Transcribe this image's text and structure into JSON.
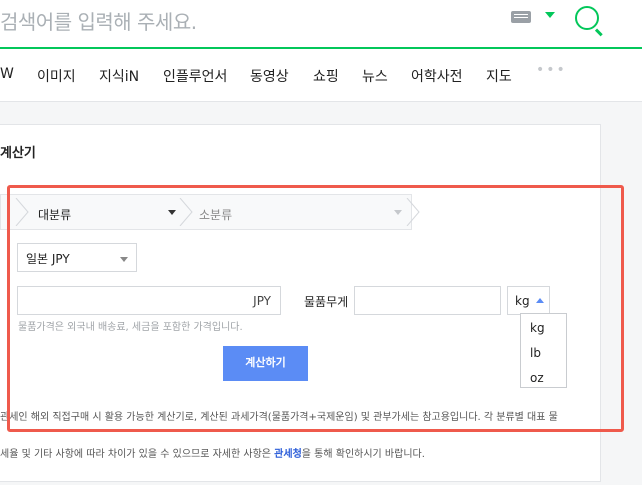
{
  "search": {
    "placeholder": "검색어를 입력해 주세요."
  },
  "tabs": [
    "W",
    "이미지",
    "지식iN",
    "인플루언서",
    "동영상",
    "쇼핑",
    "뉴스",
    "어학사전",
    "지도"
  ],
  "more_label": "•••",
  "calculator": {
    "title": "계산기",
    "major_category": "대분류",
    "minor_category": "소분류",
    "country_value": "일본 JPY",
    "price_unit": "JPY",
    "weight_label": "물품무게",
    "weight_unit": "kg",
    "weight_options": [
      "kg",
      "lb",
      "oz"
    ],
    "hint": "물품가격은 외국내 배송료, 세금을 포함한 가격입니다.",
    "button": "계산하기"
  },
  "notes": {
    "line1": "관세인 해외 직접구매 시 활용 가능한 계산기로, 계산된 과세가격(물품가격+국제운임) 및 관부가세는 참고용입니다. 각 분류별 대표 물",
    "line3_prefix": "세율 및 기타 사항에 따라 차이가 있을 수 있으므로 자세한 사항은 ",
    "link": "관세청",
    "line3_suffix": "을 통해 확인하시기 바랍니다."
  },
  "colors": {
    "brand_green": "#03c75a",
    "button_blue": "#5b8cf5",
    "highlight_red": "#ef5a4c",
    "link": "#2a5cd8"
  }
}
